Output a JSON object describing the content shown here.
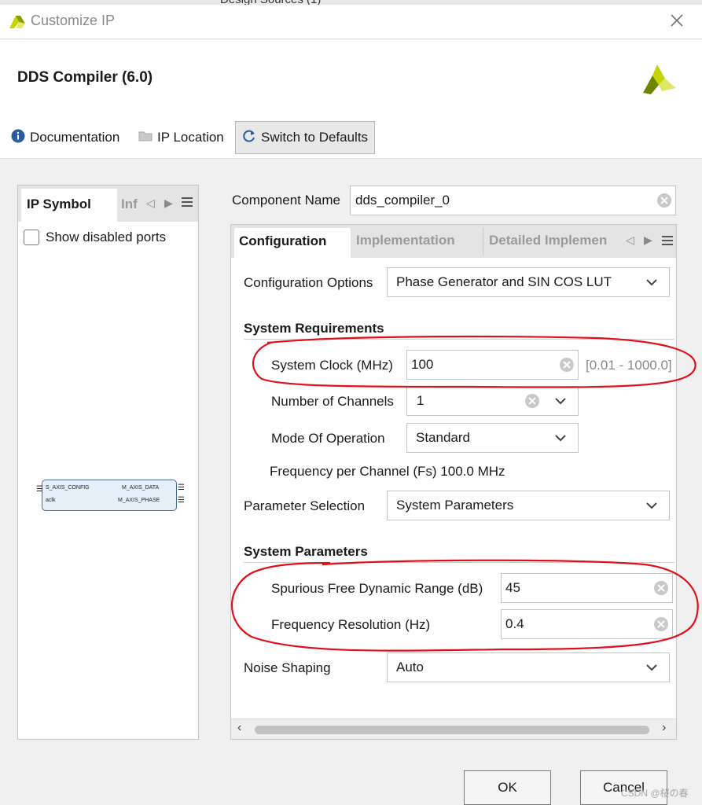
{
  "background_app": {
    "partial_text": "Design Sources (1)"
  },
  "window": {
    "title": "Customize IP"
  },
  "header": {
    "ip_name": "DDS Compiler (6.0)"
  },
  "toolbar": {
    "documentation": "Documentation",
    "ip_location": "IP Location",
    "switch_defaults": "Switch to Defaults"
  },
  "left_panel": {
    "tab_active": "IP Symbol",
    "tab_inactive": "Inf",
    "show_disabled_ports": "Show disabled ports",
    "symbol": {
      "port_s_axis_config": "S_AXIS_CONFIG",
      "port_aclk": "aclk",
      "port_m_axis_data": "M_AXIS_DATA",
      "port_m_axis_phase": "M_AXIS_PHASE"
    }
  },
  "component": {
    "label": "Component Name",
    "value": "dds_compiler_0"
  },
  "tabs": {
    "configuration": "Configuration",
    "implementation": "Implementation",
    "detailed": "Detailed Implemen"
  },
  "config": {
    "options_label": "Configuration Options",
    "options_value": "Phase Generator and SIN COS LUT",
    "sys_req_title": "System Requirements",
    "clock_label": "System Clock (MHz)",
    "clock_value": "100",
    "clock_range": "[0.01 - 1000.0]",
    "channels_label": "Number of Channels",
    "channels_value": "1",
    "mode_label": "Mode Of Operation",
    "mode_value": "Standard",
    "freq_per_channel": "Frequency per Channel (Fs) 100.0 MHz",
    "param_sel_label": "Parameter Selection",
    "param_sel_value": "System Parameters",
    "sys_params_title": "System Parameters",
    "sfdr_label": "Spurious Free Dynamic Range (dB)",
    "sfdr_value": "45",
    "freq_res_label": "Frequency Resolution (Hz)",
    "freq_res_value": "0.4",
    "noise_label": "Noise Shaping",
    "noise_value": "Auto"
  },
  "buttons": {
    "ok": "OK",
    "cancel": "Cancel"
  },
  "watermark": "CSDN @桜の春",
  "colors": {
    "annotation_red": "#e0101a",
    "xilinx_yellow": "#c5d400",
    "info_blue": "#2a6db5"
  }
}
